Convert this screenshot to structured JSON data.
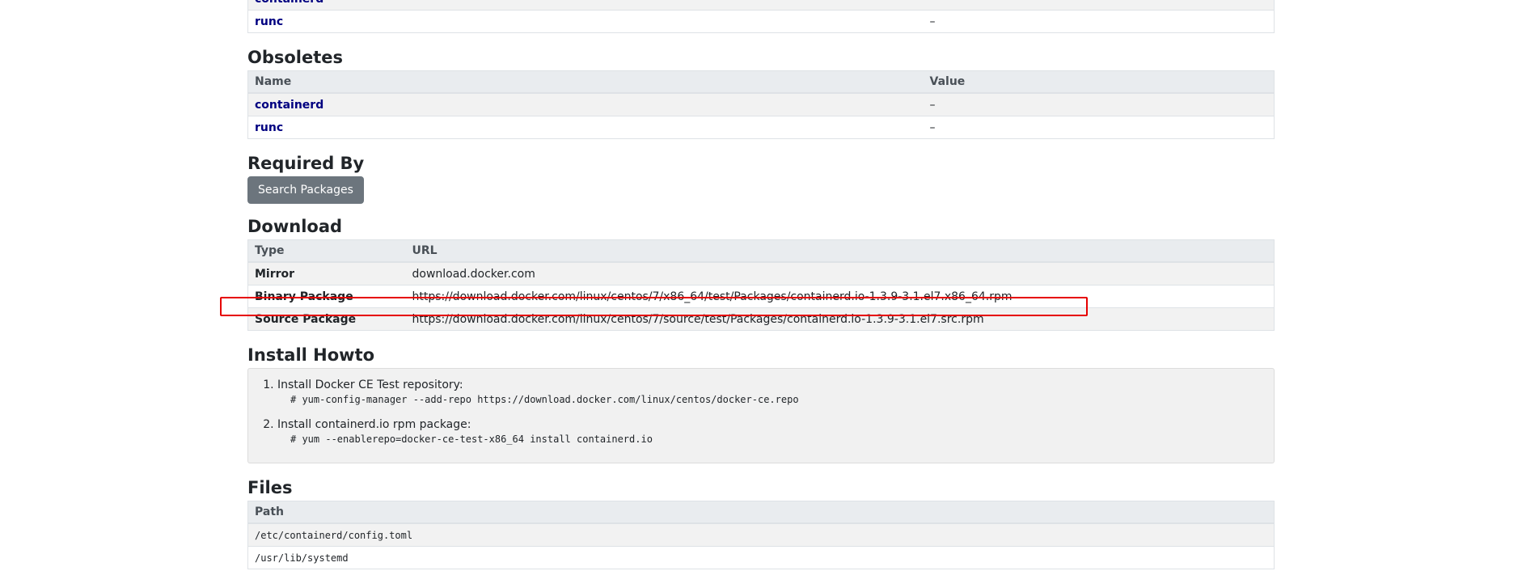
{
  "top_table": {
    "rows": [
      {
        "name": "containerd",
        "value": ""
      },
      {
        "name": "runc",
        "value": "–"
      }
    ]
  },
  "obsoletes": {
    "heading": "Obsoletes",
    "columns": [
      "Name",
      "Value"
    ],
    "rows": [
      {
        "name": "containerd",
        "value": "–"
      },
      {
        "name": "runc",
        "value": "–"
      }
    ]
  },
  "required_by": {
    "heading": "Required By",
    "button_label": "Search Packages"
  },
  "download": {
    "heading": "Download",
    "columns": [
      "Type",
      "URL"
    ],
    "rows": [
      {
        "type": "Mirror",
        "url": "download.docker.com"
      },
      {
        "type": "Binary Package",
        "url": "https://download.docker.com/linux/centos/7/x86_64/test/Packages/containerd.io-1.3.9-3.1.el7.x86_64.rpm"
      },
      {
        "type": "Source Package",
        "url": "https://download.docker.com/linux/centos/7/source/test/Packages/containerd.io-1.3.9-3.1.el7.src.rpm"
      }
    ]
  },
  "install_howto": {
    "heading": "Install Howto",
    "steps": [
      {
        "text": "Install Docker CE Test repository:",
        "command": "# yum-config-manager --add-repo https://download.docker.com/linux/centos/docker-ce.repo"
      },
      {
        "text": "Install containerd.io rpm package:",
        "command": "# yum --enablerepo=docker-ce-test-x86_64 install containerd.io"
      }
    ]
  },
  "files": {
    "heading": "Files",
    "columns": [
      "Path"
    ],
    "rows": [
      {
        "path": "/etc/containerd/config.toml"
      },
      {
        "path": "/usr/lib/systemd"
      }
    ]
  },
  "colors": {
    "link": "#000080",
    "highlight_border": "#e60000",
    "button_bg": "#6c757d"
  }
}
